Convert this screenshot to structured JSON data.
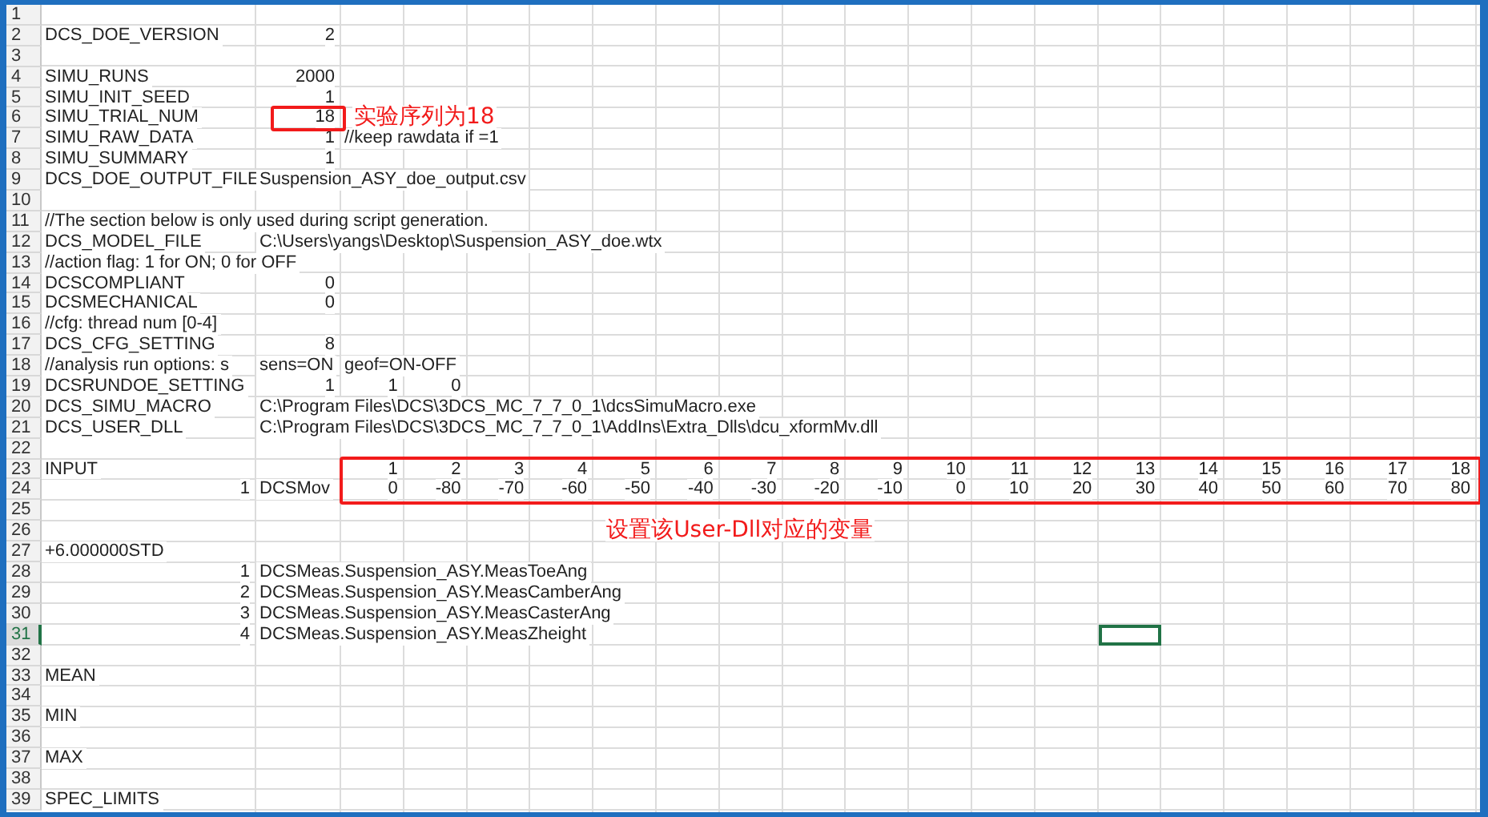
{
  "sheet": {
    "rows": [
      {
        "number": "1",
        "selected": false
      },
      {
        "number": "2",
        "selected": false,
        "cells": [
          {
            "kind": "text",
            "text": "DCS_DOE_VERSION"
          },
          {
            "kind": "number",
            "text": "2"
          }
        ]
      },
      {
        "number": "3",
        "selected": false
      },
      {
        "number": "4",
        "selected": false,
        "cells": [
          {
            "kind": "text",
            "text": "SIMU_RUNS"
          },
          {
            "kind": "number",
            "text": "2000"
          }
        ]
      },
      {
        "number": "5",
        "selected": false,
        "cells": [
          {
            "kind": "text",
            "text": "SIMU_INIT_SEED"
          },
          {
            "kind": "number",
            "text": "1"
          }
        ]
      },
      {
        "number": "6",
        "selected": false,
        "cells": [
          {
            "kind": "text",
            "text": "SIMU_TRIAL_NUM"
          }
        ],
        "boxed": [
          {
            "kind": "number",
            "text": "18"
          }
        ],
        "note": "实验序列为18"
      },
      {
        "number": "7",
        "selected": false,
        "cells": [
          {
            "kind": "text",
            "text": "SIMU_RAW_DATA"
          },
          {
            "kind": "number",
            "text": "1"
          },
          {
            "kind": "text",
            "text": "//keep rawdata if =1"
          }
        ]
      },
      {
        "number": "8",
        "selected": false,
        "cells": [
          {
            "kind": "text",
            "text": "SIMU_SUMMARY"
          },
          {
            "kind": "number",
            "text": "1"
          }
        ]
      },
      {
        "number": "9",
        "selected": false,
        "cells": [
          {
            "kind": "text",
            "text": "DCS_DOE_OUTPUT_FILE"
          },
          {
            "kind": "text",
            "text": "Suspension_ASY_doe_output.csv"
          }
        ]
      },
      {
        "number": "10",
        "selected": false
      },
      {
        "number": "11",
        "selected": false,
        "cells": [
          {
            "kind": "text",
            "text": "//The section below is only used during script generation."
          }
        ]
      },
      {
        "number": "12",
        "selected": false,
        "cells": [
          {
            "kind": "text",
            "text": "DCS_MODEL_FILE"
          },
          {
            "kind": "text",
            "text": "C:\\Users\\yangs\\Desktop\\Suspension_ASY_doe.wtx"
          }
        ]
      },
      {
        "number": "13",
        "selected": false,
        "cells": [
          {
            "kind": "text",
            "text": "//action flag: 1 for ON; 0 for OFF"
          }
        ]
      },
      {
        "number": "14",
        "selected": false,
        "cells": [
          {
            "kind": "text",
            "text": "DCSCOMPLIANT"
          },
          {
            "kind": "number",
            "text": "0"
          }
        ]
      },
      {
        "number": "15",
        "selected": false,
        "cells": [
          {
            "kind": "text",
            "text": "DCSMECHANICAL"
          },
          {
            "kind": "number",
            "text": "0"
          }
        ]
      },
      {
        "number": "16",
        "selected": false,
        "cells": [
          {
            "kind": "text",
            "text": "//cfg: thread num [0-4]"
          }
        ]
      },
      {
        "number": "17",
        "selected": false,
        "cells": [
          {
            "kind": "text",
            "text": "DCS_CFG_SETTING"
          },
          {
            "kind": "number",
            "text": "8"
          }
        ]
      },
      {
        "number": "18",
        "selected": false,
        "cells": [
          {
            "kind": "text",
            "text": "//analysis run options: s"
          },
          {
            "kind": "text",
            "text": "sens=ON"
          },
          {
            "kind": "text",
            "text": "geof=ON-OFF"
          }
        ]
      },
      {
        "number": "19",
        "selected": false,
        "cells": [
          {
            "kind": "text",
            "text": "DCSRUNDOE_SETTING"
          },
          {
            "kind": "number",
            "text": "1"
          },
          {
            "kind": "number",
            "text": "1"
          },
          {
            "kind": "number",
            "text": "0"
          }
        ]
      },
      {
        "number": "20",
        "selected": false,
        "cells": [
          {
            "kind": "text",
            "text": "DCS_SIMU_MACRO"
          },
          {
            "kind": "text",
            "text": "C:\\Program Files\\DCS\\3DCS_MC_7_7_0_1\\dcsSimuMacro.exe"
          }
        ]
      },
      {
        "number": "21",
        "selected": false,
        "cells": [
          {
            "kind": "text",
            "text": "DCS_USER_DLL"
          },
          {
            "kind": "text",
            "text": "C:\\Program Files\\DCS\\3DCS_MC_7_7_0_1\\AddIns\\Extra_Dlls\\dcu_xformMv.dll"
          }
        ]
      },
      {
        "number": "22",
        "selected": false
      },
      {
        "number": "23",
        "selected": false,
        "cells": [
          {
            "kind": "text",
            "text": "INPUT"
          },
          {
            "kind": "empty"
          }
        ],
        "boxed": [
          {
            "kind": "number",
            "text": "1"
          },
          {
            "kind": "number",
            "text": "2"
          },
          {
            "kind": "number",
            "text": "3"
          },
          {
            "kind": "number",
            "text": "4"
          },
          {
            "kind": "number",
            "text": "5"
          },
          {
            "kind": "number",
            "text": "6"
          },
          {
            "kind": "number",
            "text": "7"
          },
          {
            "kind": "number",
            "text": "8"
          },
          {
            "kind": "number",
            "text": "9"
          },
          {
            "kind": "number",
            "text": "10"
          },
          {
            "kind": "number",
            "text": "11"
          },
          {
            "kind": "number",
            "text": "12"
          },
          {
            "kind": "number",
            "text": "13"
          },
          {
            "kind": "number",
            "text": "14"
          },
          {
            "kind": "number",
            "text": "15"
          },
          {
            "kind": "number",
            "text": "16"
          },
          {
            "kind": "number",
            "text": "17"
          },
          {
            "kind": "number",
            "text": "18"
          }
        ]
      },
      {
        "number": "24",
        "selected": false,
        "cells": [
          {
            "kind": "number",
            "text": "1"
          },
          {
            "kind": "text",
            "text": "DCSMov"
          }
        ],
        "boxed": [
          {
            "kind": "number",
            "text": "0"
          },
          {
            "kind": "number",
            "text": "-80"
          },
          {
            "kind": "number",
            "text": "-70"
          },
          {
            "kind": "number",
            "text": "-60"
          },
          {
            "kind": "number",
            "text": "-50"
          },
          {
            "kind": "number",
            "text": "-40"
          },
          {
            "kind": "number",
            "text": "-30"
          },
          {
            "kind": "number",
            "text": "-20"
          },
          {
            "kind": "number",
            "text": "-10"
          },
          {
            "kind": "number",
            "text": "0"
          },
          {
            "kind": "number",
            "text": "10"
          },
          {
            "kind": "number",
            "text": "20"
          },
          {
            "kind": "number",
            "text": "30"
          },
          {
            "kind": "number",
            "text": "40"
          },
          {
            "kind": "number",
            "text": "50"
          },
          {
            "kind": "number",
            "text": "60"
          },
          {
            "kind": "number",
            "text": "70"
          },
          {
            "kind": "number",
            "text": "80"
          }
        ]
      },
      {
        "number": "25",
        "selected": false
      },
      {
        "number": "26",
        "selected": false,
        "cells": [
          {
            "kind": "empty"
          },
          {
            "kind": "empty"
          },
          {
            "kind": "empty"
          },
          {
            "kind": "empty"
          },
          {
            "kind": "empty"
          },
          {
            "kind": "empty"
          },
          {
            "kind": "note",
            "text": "设置该User-Dll对应的变量"
          }
        ]
      },
      {
        "number": "27",
        "selected": false,
        "cells": [
          {
            "kind": "text",
            "text": "+6.000000STD"
          }
        ]
      },
      {
        "number": "28",
        "selected": false,
        "cells": [
          {
            "kind": "number",
            "text": "1"
          },
          {
            "kind": "text",
            "text": "DCSMeas.Suspension_ASY.MeasToeAng"
          }
        ]
      },
      {
        "number": "29",
        "selected": false,
        "cells": [
          {
            "kind": "number",
            "text": "2"
          },
          {
            "kind": "text",
            "text": "DCSMeas.Suspension_ASY.MeasCamberAng"
          }
        ]
      },
      {
        "number": "30",
        "selected": false,
        "cells": [
          {
            "kind": "number",
            "text": "3"
          },
          {
            "kind": "text",
            "text": "DCSMeas.Suspension_ASY.MeasCasterAng"
          }
        ]
      },
      {
        "number": "31",
        "selected": true,
        "cells": [
          {
            "kind": "number",
            "text": "4"
          },
          {
            "kind": "text",
            "text": "DCSMeas.Suspension_ASY.MeasZheight"
          },
          {
            "kind": "empty"
          },
          {
            "kind": "empty"
          },
          {
            "kind": "empty"
          },
          {
            "kind": "empty"
          },
          {
            "kind": "empty"
          },
          {
            "kind": "empty"
          },
          {
            "kind": "empty"
          },
          {
            "kind": "empty"
          },
          {
            "kind": "empty"
          },
          {
            "kind": "empty"
          },
          {
            "kind": "empty"
          },
          {
            "kind": "empty"
          },
          {
            "kind": "cursor"
          }
        ]
      },
      {
        "number": "32",
        "selected": false
      },
      {
        "number": "33",
        "selected": false,
        "cells": [
          {
            "kind": "text",
            "text": "MEAN"
          }
        ]
      },
      {
        "number": "34",
        "selected": false
      },
      {
        "number": "35",
        "selected": false,
        "cells": [
          {
            "kind": "text",
            "text": "MIN"
          }
        ]
      },
      {
        "number": "36",
        "selected": false
      },
      {
        "number": "37",
        "selected": false,
        "cells": [
          {
            "kind": "text",
            "text": "MAX"
          }
        ]
      },
      {
        "number": "38",
        "selected": false
      },
      {
        "number": "39",
        "selected": false,
        "cells": [
          {
            "kind": "text",
            "text": "SPEC_LIMITS"
          }
        ]
      }
    ]
  }
}
